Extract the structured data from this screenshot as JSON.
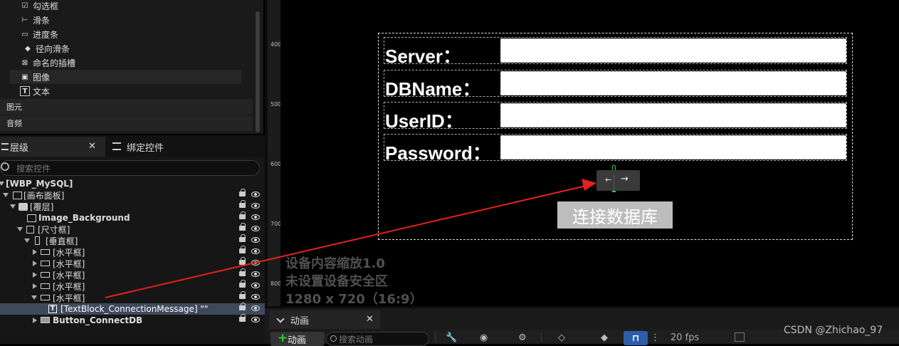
{
  "palette": {
    "items": [
      {
        "label": "勾选框",
        "icon": "checkbox-icon"
      },
      {
        "label": "滑条",
        "icon": "slider-icon"
      },
      {
        "label": "进度条",
        "icon": "progressbar-icon"
      },
      {
        "label": "径向滑条",
        "icon": "radial-slider-icon"
      },
      {
        "label": "命名的插槽",
        "icon": "named-slot-icon"
      },
      {
        "label": "图像",
        "icon": "image-icon"
      },
      {
        "label": "文本",
        "icon": "text-icon"
      }
    ],
    "categories": [
      "图元",
      "音频"
    ]
  },
  "hierarchy": {
    "tab_label": "层级",
    "bind_tab_label": "绑定控件",
    "search_placeholder": "搜索控件",
    "tree": [
      {
        "label": "[WBP_MySQL]"
      },
      {
        "label": "[画布面板]"
      },
      {
        "label": "[覆层]"
      },
      {
        "label": "Image_Background"
      },
      {
        "label": "[尺寸框]"
      },
      {
        "label": "[垂直框]"
      },
      {
        "label": "[水平框]"
      },
      {
        "label": "[水平框]"
      },
      {
        "label": "[水平框]"
      },
      {
        "label": "[水平框]"
      },
      {
        "label": "[水平框]"
      },
      {
        "label": "[TextBlock_ConnectionMessage] \"\""
      },
      {
        "label": "Button_ConnectDB"
      }
    ]
  },
  "ruler": {
    "marks": [
      "400",
      "500",
      "600",
      "700",
      "800"
    ]
  },
  "canvas": {
    "form": [
      {
        "label": "Server："
      },
      {
        "label": "DBName："
      },
      {
        "label": "UserID："
      },
      {
        "label": "Password："
      }
    ],
    "button_label": "连接数据库",
    "info": [
      "设备内容缩放1.0",
      "未设置设备安全区",
      "1280 x 720（16:9）"
    ]
  },
  "animation": {
    "tab_label": "动画",
    "add_label": "动画",
    "search_placeholder": "搜索动画",
    "fps": "20 fps"
  },
  "watermark": "CSDN @Zhichao_97",
  "colors": {
    "selection": "#3e4a5c",
    "accent": "#2b5da8",
    "arrow": "#e5211d",
    "anchor": "#33cc33"
  }
}
